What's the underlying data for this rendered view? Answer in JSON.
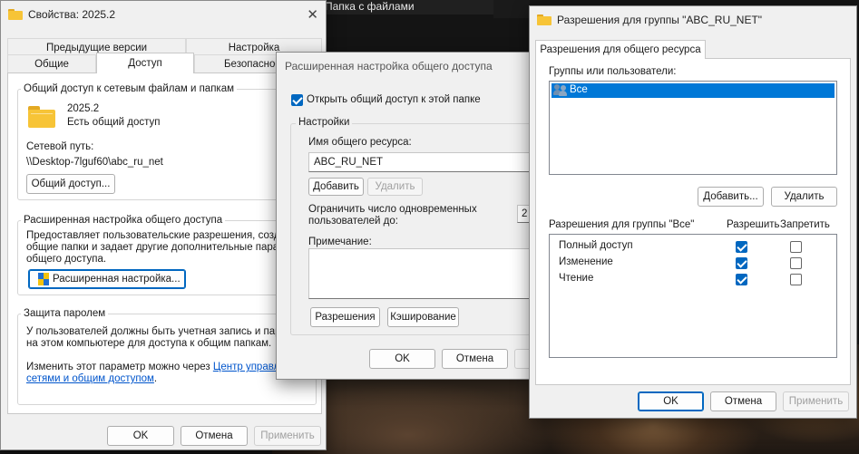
{
  "background": {
    "explorer_title": "Папка с файлами"
  },
  "properties": {
    "title": "Свойства: 2025.2",
    "tabs_row1": [
      "Предыдущие версии",
      "Настройка"
    ],
    "tabs_row2": [
      "Общие",
      "Доступ",
      "Безопаснос"
    ],
    "active_tab": "Доступ",
    "network_group": "Общий доступ к сетевым файлам и папкам",
    "folder_name": "2025.2",
    "share_status": "Есть общий доступ",
    "network_path_label": "Сетевой путь:",
    "network_path": "\\\\Desktop-7lguf60\\abc_ru_net",
    "share_button": "Общий доступ...",
    "advanced_group": "Расширенная настройка общего доступа",
    "advanced_desc": [
      "Предоставляет пользовательские разрешения, создает",
      "общие папки и задает другие дополнительные параме",
      "общего доступа."
    ],
    "advanced_button": "Расширенная настройка...",
    "password_group": "Защита паролем",
    "password_desc": [
      "У пользователей должны быть учетная запись и парол",
      "на этом компьютере для доступа к общим папкам."
    ],
    "change_text": "Изменить этот параметр можно через ",
    "change_link_1": "Центр управлен",
    "change_link_2": "сетями и общим доступом",
    "change_suffix": ".",
    "ok": "OK",
    "cancel": "Отмена",
    "apply": "Применить"
  },
  "advanced": {
    "title": "Расширенная настройка общего доступа",
    "share_checkbox": "Открыть общий доступ к этой папке",
    "share_checked": true,
    "settings_group": "Настройки",
    "share_name_label": "Имя общего ресурса:",
    "share_name_value": "ABC_RU_NET",
    "add_button": "Добавить",
    "remove_button": "Удалить",
    "limit_label_1": "Ограничить число одновременных",
    "limit_label_2": "пользователей до:",
    "limit_value": "2",
    "comment_label": "Примечание:",
    "permissions_button": "Разрешения",
    "caching_button": "Кэширование",
    "ok": "OK",
    "cancel": "Отмена"
  },
  "permissions": {
    "title": "Разрешения для группы \"ABC_RU_NET\"",
    "tab": "Разрешения для общего ресурса",
    "groups_label": "Группы или пользователи:",
    "groups": [
      {
        "name": "Все",
        "selected": true
      }
    ],
    "add_button": "Добавить...",
    "remove_button": "Удалить",
    "perm_header": "Разрешения для группы \"Все\"",
    "allow_col": "Разрешить",
    "deny_col": "Запретить",
    "perms": [
      {
        "name": "Полный доступ",
        "allow": true,
        "deny": false
      },
      {
        "name": "Изменение",
        "allow": true,
        "deny": false
      },
      {
        "name": "Чтение",
        "allow": true,
        "deny": false
      }
    ],
    "ok": "OK",
    "cancel": "Отмена",
    "apply": "Применить"
  },
  "colors": {
    "accent": "#0067c0",
    "selection": "#0078d7",
    "folder": "#f7c437"
  }
}
